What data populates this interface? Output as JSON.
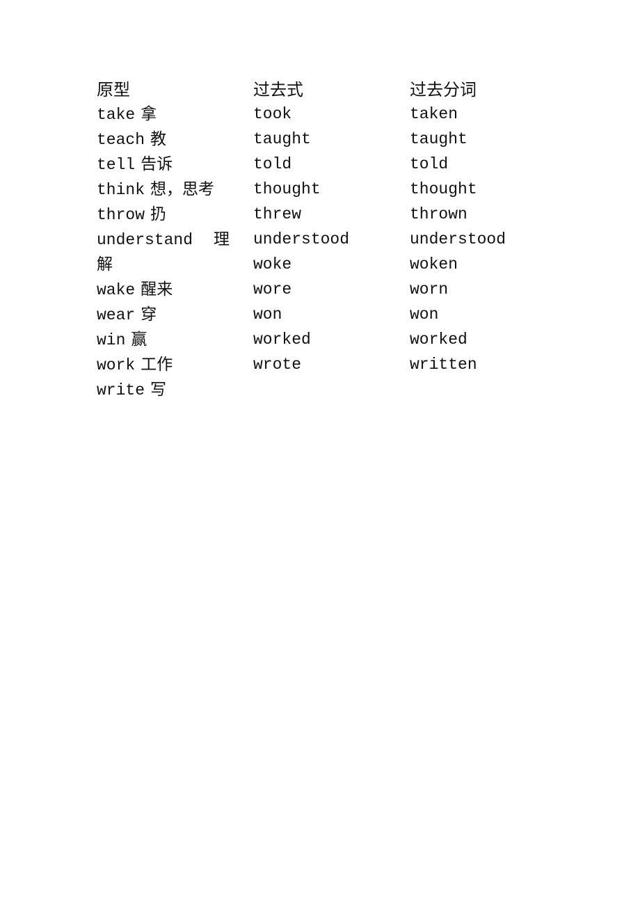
{
  "document": {
    "headers": {
      "base": "原型",
      "past": "过去式",
      "past_participle": "过去分词"
    },
    "base_forms": [
      {
        "word": "take",
        "meaning": "拿"
      },
      {
        "word": "teach",
        "meaning": "教"
      },
      {
        "word": "tell",
        "meaning": "告诉"
      },
      {
        "word": "think",
        "meaning": "想，思考"
      },
      {
        "word": "throw",
        "meaning": "扔"
      },
      {
        "word": "understand",
        "meaning": "理"
      },
      {
        "word": "",
        "meaning": "解"
      },
      {
        "word": "wake",
        "meaning": "醒来"
      },
      {
        "word": "wear",
        "meaning": "穿"
      },
      {
        "word": "win",
        "meaning": "赢"
      },
      {
        "word": "work",
        "meaning": "工作"
      },
      {
        "word": "write",
        "meaning": "写"
      }
    ],
    "past_forms": [
      "took",
      "taught",
      "told",
      "thought",
      "threw",
      "understood",
      "woke",
      "wore",
      "won",
      "worked",
      "wrote"
    ],
    "past_participles": [
      "taken",
      "taught",
      "told",
      "thought",
      "thrown",
      "understood",
      "woken",
      "worn",
      "won",
      "worked",
      "written"
    ]
  }
}
